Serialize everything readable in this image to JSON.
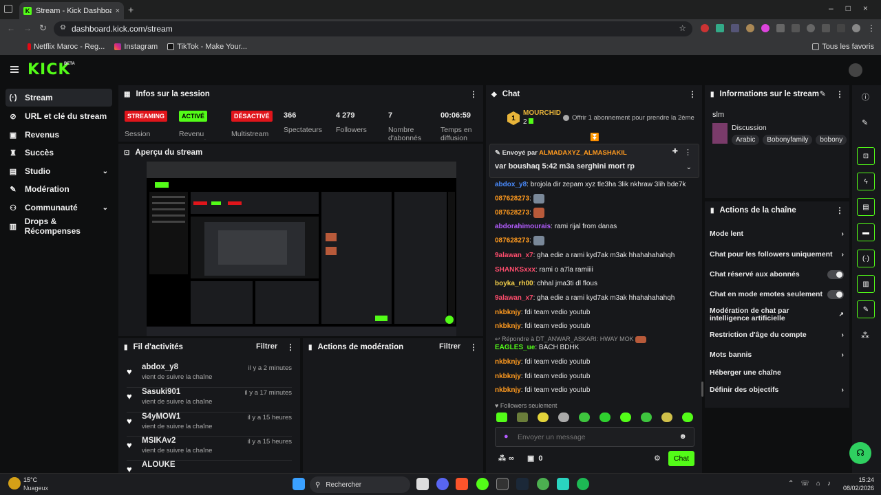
{
  "browser": {
    "tab_title": "Stream - Kick Dashboard",
    "url": "dashboard.kick.com/stream",
    "bookmarks": [
      "Netflix Maroc - Reg...",
      "Instagram",
      "TikTok - Make Your..."
    ],
    "all_bookmarks": "Tous les favoris"
  },
  "header": {
    "logo": "KICK",
    "beta": "BETA"
  },
  "sidebar": {
    "items": [
      {
        "label": "Stream",
        "icon": "broadcast-icon"
      },
      {
        "label": "URL et clé du stream",
        "icon": "link-icon"
      },
      {
        "label": "Revenus",
        "icon": "wallet-icon"
      },
      {
        "label": "Succès",
        "icon": "trophy-icon"
      },
      {
        "label": "Studio",
        "icon": "studio-icon"
      },
      {
        "label": "Modération",
        "icon": "wrench-icon"
      },
      {
        "label": "Communauté",
        "icon": "community-icon"
      },
      {
        "label": "Drops & Récompenses",
        "icon": "drops-icon"
      }
    ]
  },
  "session": {
    "title": "Infos sur la session",
    "stats": [
      {
        "badge": "STREAMING",
        "label": "Session"
      },
      {
        "badge": "ACTIVÉ",
        "label": "Revenu Partenaires"
      },
      {
        "badge": "DÉSACTIVÉ",
        "label": "Multistream"
      },
      {
        "value": "366",
        "label": "Spectateurs"
      },
      {
        "value": "4 279",
        "label": "Followers"
      },
      {
        "value": "7",
        "label": "Nombre d'abonnés"
      },
      {
        "value": "00:06:59",
        "label": "Temps en diffusion"
      }
    ]
  },
  "preview": {
    "title": "Aperçu du stream"
  },
  "activity": {
    "title": "Fil d'activités",
    "filter": "Filtrer",
    "items": [
      {
        "name": "abdox_y8",
        "sub": "vient de suivre la chaîne",
        "time": "il y a 2 minutes"
      },
      {
        "name": "Sasuki901",
        "sub": "vient de suivre la chaîne",
        "time": "il y a 17 minutes"
      },
      {
        "name": "S4yMOW1",
        "sub": "vient de suivre la chaîne",
        "time": "il y a 15 heures"
      },
      {
        "name": "MSIKAv2",
        "sub": "vient de suivre la chaîne",
        "time": "il y a 15 heures"
      },
      {
        "name": "ALOUKE",
        "sub": "",
        "time": ""
      }
    ]
  },
  "moderation": {
    "title": "Actions de modération",
    "filter": "Filtrer"
  },
  "chat": {
    "title": "Chat",
    "top_gifter": {
      "name": "MOURCHID",
      "count": "2",
      "rank": "1"
    },
    "gift_offer": "Offrir 1 abonnement pour prendre la 2ème",
    "pinned": {
      "prefix": "Envoyé par",
      "author": "ALMADAXYZ_ALMASHAKIL",
      "message": "var boushaq 5:42 m3a serghini mort rp"
    },
    "messages": [
      {
        "user": "abdox_y8",
        "text": "brojola dir zepam xyz tle3ha 3lik nkhraw 3lih bde7k",
        "color": "#4a8cff"
      },
      {
        "user": "087628273",
        "text": "",
        "color": "#ff9a1f",
        "emote": "#7a8899"
      },
      {
        "user": "087628273",
        "text": "",
        "color": "#ff9a1f",
        "emote": "#b85a3a"
      },
      {
        "user": "abdorahimourais",
        "text": "rami rijal from danas",
        "color": "#b45cff"
      },
      {
        "user": "087628273",
        "text": "",
        "color": "#ff9a1f",
        "emote": "#7a8899"
      },
      {
        "user": "9alawan_x7",
        "text": "gha edie a rami kyd7ak m3ak hhahahahahqh",
        "color": "#ff4d6d"
      },
      {
        "user": "SHANKSxxx",
        "text": "rami o a7la ramiiii",
        "color": "#ff4d6d"
      },
      {
        "user": "boyka_rh00",
        "text": "chhal jma3ti dl flous",
        "color": "#f5d04a"
      },
      {
        "user": "9alawan_x7",
        "text": "gha edie a rami kyd7ak m3ak hhahahahahqh",
        "color": "#ff4d6d"
      },
      {
        "user": "nkbknjy",
        "text": "fdi team vedio youtub",
        "color": "#ff9a1f"
      },
      {
        "user": "nkbknjy",
        "text": "fdi team vedio youtub",
        "color": "#ff9a1f"
      },
      {
        "user": "EAGLES_ue",
        "text": "BACH BDHK",
        "color": "#53fc18",
        "reply": "Répondre à DT_ANWAR_ASKARI: HWAY MOK"
      },
      {
        "user": "nkbknjy",
        "text": "fdi team vedio youtub",
        "color": "#ff9a1f"
      },
      {
        "user": "nkbknjy",
        "text": "fdi team vedio youtub",
        "color": "#ff9a1f"
      },
      {
        "user": "nkbknjy",
        "text": "fdi team vedio youtub",
        "color": "#ff9a1f"
      }
    ],
    "followers_only": "Followers seulement",
    "input_placeholder": "Envoyer un message",
    "points": "∞",
    "gifts": "0",
    "send": "Chat"
  },
  "stream_info": {
    "title": "Informations sur le stream",
    "stream_title": "slm",
    "category": "Discussion",
    "tags": [
      "Arabic",
      "Bobonyfamily",
      "bobony"
    ]
  },
  "channel_actions": {
    "title": "Actions de la chaîne",
    "items": [
      {
        "label": "Mode lent",
        "control": "chevron"
      },
      {
        "label": "Chat pour les followers uniquement",
        "control": "chevron"
      },
      {
        "label": "Chat réservé aux abonnés",
        "control": "toggle"
      },
      {
        "label": "Chat en mode emotes seulement",
        "control": "toggle"
      },
      {
        "label": "Modération de chat par intelligence artificielle",
        "control": "external"
      },
      {
        "label": "Restriction d'âge du compte",
        "control": "chevron"
      },
      {
        "label": "Mots bannis",
        "control": "chevron"
      },
      {
        "label": "Héberger une chaîne",
        "control": "none"
      },
      {
        "label": "Définir des objectifs",
        "control": "chevron"
      }
    ]
  },
  "taskbar": {
    "weather_temp": "15°C",
    "weather_desc": "Nuageux",
    "search": "Rechercher",
    "time": "15:24",
    "date": "08/02/2026"
  },
  "colors": {
    "accent": "#53fc18",
    "danger": "#e0151b",
    "panel": "#17181b",
    "bg": "#0e0f10"
  }
}
